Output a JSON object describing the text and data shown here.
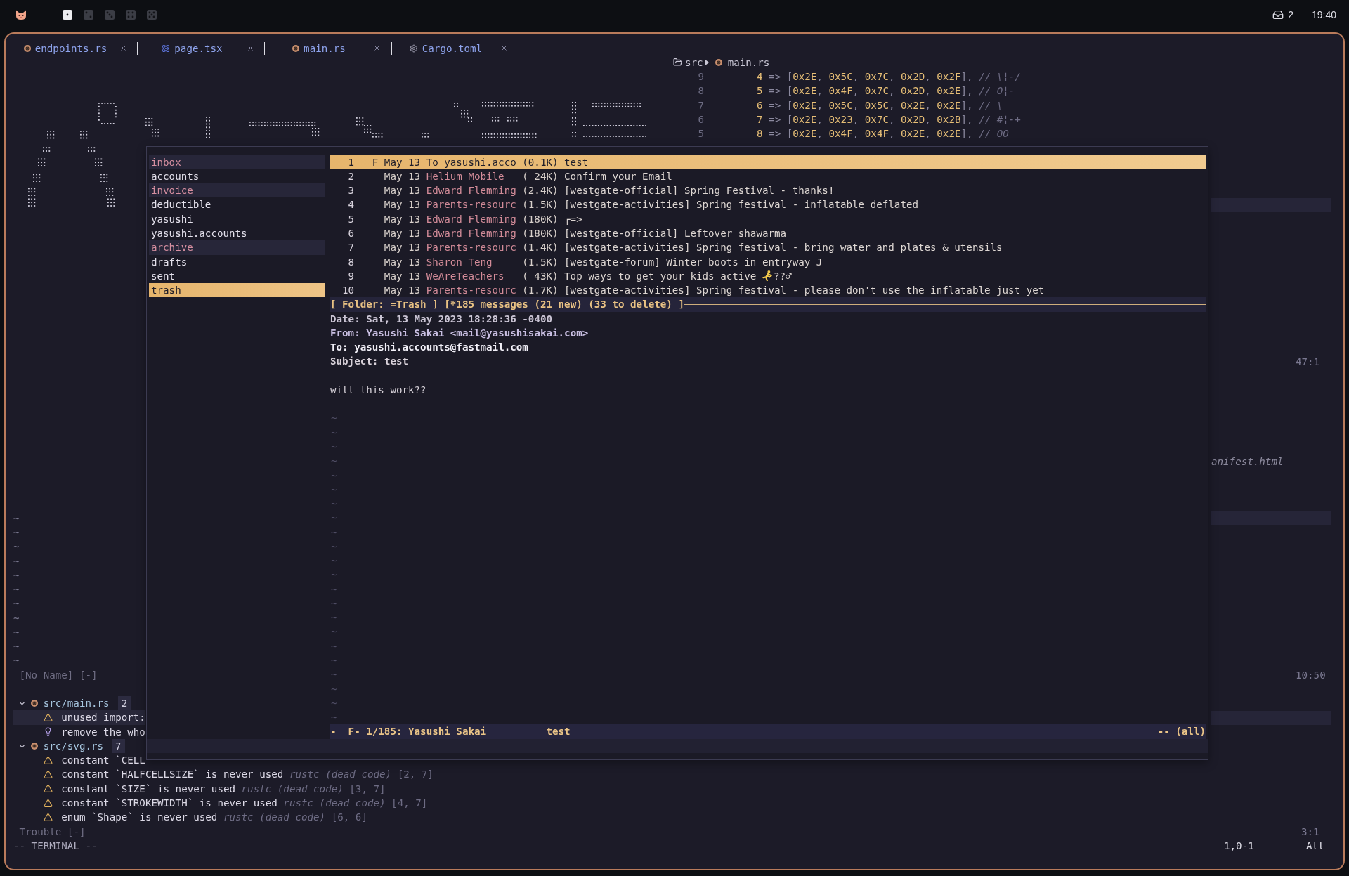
{
  "top_bar": {
    "workspaces": [
      {
        "selected": true
      },
      {
        "selected": false
      },
      {
        "selected": false
      },
      {
        "selected": false
      },
      {
        "selected": false
      }
    ],
    "notification_count": "2",
    "clock": "19:40"
  },
  "tabs": [
    {
      "label": "endpoints.rs",
      "kind": "rust"
    },
    {
      "label": "page.tsx",
      "kind": "react"
    },
    {
      "label": "main.rs",
      "kind": "rust"
    },
    {
      "label": "Cargo.toml",
      "kind": "config"
    }
  ],
  "editor_right": {
    "breadcrumb": {
      "folder": "src",
      "file": "main.rs"
    },
    "code_lines": [
      {
        "number": "9",
        "tokens": [
          {
            "kind": "number",
            "text": "4"
          },
          {
            "kind": "punct",
            "text": " => ["
          },
          {
            "kind": "number",
            "text": "0x2E"
          },
          {
            "kind": "punct",
            "text": ", "
          },
          {
            "kind": "number",
            "text": "0x5C"
          },
          {
            "kind": "punct",
            "text": ", "
          },
          {
            "kind": "number",
            "text": "0x7C"
          },
          {
            "kind": "punct",
            "text": ", "
          },
          {
            "kind": "number",
            "text": "0x2D"
          },
          {
            "kind": "punct",
            "text": ", "
          },
          {
            "kind": "number",
            "text": "0x2F"
          },
          {
            "kind": "punct",
            "text": "], "
          },
          {
            "kind": "comment",
            "text": "// \\¦-/"
          }
        ]
      },
      {
        "number": "8",
        "tokens": [
          {
            "kind": "number",
            "text": "5"
          },
          {
            "kind": "punct",
            "text": " => ["
          },
          {
            "kind": "number",
            "text": "0x2E"
          },
          {
            "kind": "punct",
            "text": ", "
          },
          {
            "kind": "number",
            "text": "0x4F"
          },
          {
            "kind": "punct",
            "text": ", "
          },
          {
            "kind": "number",
            "text": "0x7C"
          },
          {
            "kind": "punct",
            "text": ", "
          },
          {
            "kind": "number",
            "text": "0x2D"
          },
          {
            "kind": "punct",
            "text": ", "
          },
          {
            "kind": "number",
            "text": "0x2E"
          },
          {
            "kind": "punct",
            "text": "], "
          },
          {
            "kind": "comment",
            "text": "// O¦-"
          }
        ]
      },
      {
        "number": "7",
        "tokens": [
          {
            "kind": "number",
            "text": "6"
          },
          {
            "kind": "punct",
            "text": " => ["
          },
          {
            "kind": "number",
            "text": "0x2E"
          },
          {
            "kind": "punct",
            "text": ", "
          },
          {
            "kind": "number",
            "text": "0x5C"
          },
          {
            "kind": "punct",
            "text": ", "
          },
          {
            "kind": "number",
            "text": "0x5C"
          },
          {
            "kind": "punct",
            "text": ", "
          },
          {
            "kind": "number",
            "text": "0x2E"
          },
          {
            "kind": "punct",
            "text": ", "
          },
          {
            "kind": "number",
            "text": "0x2E"
          },
          {
            "kind": "punct",
            "text": "], "
          },
          {
            "kind": "comment",
            "text": "// \\"
          }
        ]
      },
      {
        "number": "6",
        "tokens": [
          {
            "kind": "number",
            "text": "7"
          },
          {
            "kind": "punct",
            "text": " => ["
          },
          {
            "kind": "number",
            "text": "0x2E"
          },
          {
            "kind": "punct",
            "text": ", "
          },
          {
            "kind": "number",
            "text": "0x23"
          },
          {
            "kind": "punct",
            "text": ", "
          },
          {
            "kind": "number",
            "text": "0x7C"
          },
          {
            "kind": "punct",
            "text": ", "
          },
          {
            "kind": "number",
            "text": "0x2D"
          },
          {
            "kind": "punct",
            "text": ", "
          },
          {
            "kind": "number",
            "text": "0x2B"
          },
          {
            "kind": "punct",
            "text": "], "
          },
          {
            "kind": "comment",
            "text": "// #¦-+"
          }
        ]
      },
      {
        "number": "5",
        "tokens": [
          {
            "kind": "number",
            "text": "8"
          },
          {
            "kind": "punct",
            "text": " => ["
          },
          {
            "kind": "number",
            "text": "0x2E"
          },
          {
            "kind": "punct",
            "text": ", "
          },
          {
            "kind": "number",
            "text": "0x4F"
          },
          {
            "kind": "punct",
            "text": ", "
          },
          {
            "kind": "number",
            "text": "0x4F"
          },
          {
            "kind": "punct",
            "text": ", "
          },
          {
            "kind": "number",
            "text": "0x2E"
          },
          {
            "kind": "punct",
            "text": ", "
          },
          {
            "kind": "number",
            "text": "0x2E"
          },
          {
            "kind": "punct",
            "text": "], "
          },
          {
            "kind": "comment",
            "text": "// OO"
          }
        ]
      }
    ],
    "status_position": "47:1",
    "partial_filename": "anifest.html",
    "lower_position": "10:50"
  },
  "editor_left": {
    "filler_lines": [
      "~",
      "~",
      "~",
      "~",
      "~",
      "~",
      "~",
      "~",
      "~",
      "~",
      "~"
    ],
    "status": "[No Name] [-]"
  },
  "trouble": {
    "groups": [
      {
        "file": "src/main.rs",
        "count": "2",
        "expanded": true,
        "items": [
          {
            "kind": "warning",
            "message": "unused import:",
            "selected": true
          },
          {
            "kind": "hint",
            "message": "remove the who",
            "selected": false
          }
        ]
      },
      {
        "file": "src/svg.rs",
        "count": "7",
        "expanded": true,
        "items": [
          {
            "kind": "warning",
            "message": "constant `CELL",
            "selected": false
          },
          {
            "kind": "warning",
            "message": "constant `HALFCELLSIZE` is never used",
            "source": "rustc (dead_code)",
            "location": "[2, 7]",
            "selected": false
          },
          {
            "kind": "warning",
            "message": "constant `SIZE` is never used",
            "source": "rustc (dead_code)",
            "location": "[3, 7]",
            "selected": false
          },
          {
            "kind": "warning",
            "message": "constant `STROKEWIDTH` is never used",
            "source": "rustc (dead_code)",
            "location": "[4, 7]",
            "selected": false
          },
          {
            "kind": "warning",
            "message": "enum `Shape` is never used",
            "source": "rustc (dead_code)",
            "location": "[6, 6]",
            "selected": false
          }
        ]
      }
    ],
    "status": "Trouble [-]",
    "position": "3:1"
  },
  "mode_line": {
    "mode": "-- TERMINAL --",
    "cursor": "1,0-1",
    "scroll": "All"
  },
  "mail": {
    "folders": [
      {
        "name": "inbox",
        "unread": true,
        "selected": false
      },
      {
        "name": "accounts",
        "unread": false,
        "selected": false
      },
      {
        "name": "invoice",
        "unread": true,
        "selected": false
      },
      {
        "name": "deductible",
        "unread": false,
        "selected": false
      },
      {
        "name": "yasushi",
        "unread": false,
        "selected": false
      },
      {
        "name": "yasushi.accounts",
        "unread": false,
        "selected": false
      },
      {
        "name": "archive",
        "unread": true,
        "selected": false
      },
      {
        "name": "drafts",
        "unread": false,
        "selected": false
      },
      {
        "name": "sent",
        "unread": false,
        "selected": false
      },
      {
        "name": "trash",
        "unread": false,
        "selected": true
      }
    ],
    "messages": [
      {
        "number": "1",
        "flag": "F",
        "date": "May 13",
        "from": "To yasushi.acco",
        "size": "(0.1K)",
        "subject": "test",
        "selected": true
      },
      {
        "number": "2",
        "date": "May 13",
        "from": "Helium Mobile",
        "size": "( 24K)",
        "subject": "Confirm your Email",
        "selected": false
      },
      {
        "number": "3",
        "date": "May 13",
        "from": "Edward Flemming",
        "size": "(2.4K)",
        "subject": "[westgate-official] Spring Festival - thanks!",
        "selected": false
      },
      {
        "number": "4",
        "date": "May 13",
        "from": "Parents-resourc",
        "size": "(1.5K)",
        "subject": "[westgate-activities] Spring festival - inflatable deflated",
        "selected": false
      },
      {
        "number": "5",
        "date": "May 13",
        "from": "Edward Flemming",
        "size": "(180K)",
        "subject": "┌=>",
        "selected": false
      },
      {
        "number": "6",
        "date": "May 13",
        "from": "Edward Flemming",
        "size": "(180K)",
        "subject": "[westgate-official] Leftover shawarma",
        "selected": false
      },
      {
        "number": "7",
        "date": "May 13",
        "from": "Parents-resourc",
        "size": "(1.4K)",
        "subject": "[westgate-activities] Spring festival - bring water and plates & utensils",
        "selected": false
      },
      {
        "number": "8",
        "date": "May 13",
        "from": "Sharon Teng",
        "size": "(1.5K)",
        "subject": "[westgate-forum] Winter boots in entryway J",
        "selected": false
      },
      {
        "number": "9",
        "date": "May 13",
        "from": "WeAreTeachers",
        "size": "( 43K)",
        "subject": "Top ways to get your kids active",
        "subject_icon": true,
        "subject_tail": "??♂",
        "selected": false
      },
      {
        "number": "10",
        "date": "May 13",
        "from": "Parents-resourc",
        "size": "(1.7K)",
        "subject": "[westgate-activities] Spring festival - please don't use the inflatable just yet",
        "selected": false
      }
    ],
    "index_status": "[ Folder: =Trash ] [*185 messages (21 new) (33 to delete) ]",
    "headers": [
      {
        "kind": "date",
        "label": "Date:",
        "value": "Sat, 13 May 2023 18:28:36 -0400"
      },
      {
        "kind": "from",
        "label": "From:",
        "value": "Yasushi Sakai <mail@yasushisakai.com>"
      },
      {
        "kind": "to",
        "label": "To:",
        "value": "yasushi.accounts@fastmail.com"
      },
      {
        "kind": "subject",
        "label": "Subject:",
        "value": "test"
      }
    ],
    "body": "will this work??",
    "filler_lines": [
      "~",
      "~",
      "~",
      "~",
      "~",
      "~",
      "~",
      "~",
      "~",
      "~",
      "~",
      "~",
      "~",
      "~",
      "~",
      "~",
      "~",
      "~",
      "~",
      "~",
      "~",
      "~"
    ],
    "pager_status": {
      "left": "-  F- 1/185: Yasushi Sakai",
      "subject": "test",
      "right": "-- (all)"
    }
  }
}
